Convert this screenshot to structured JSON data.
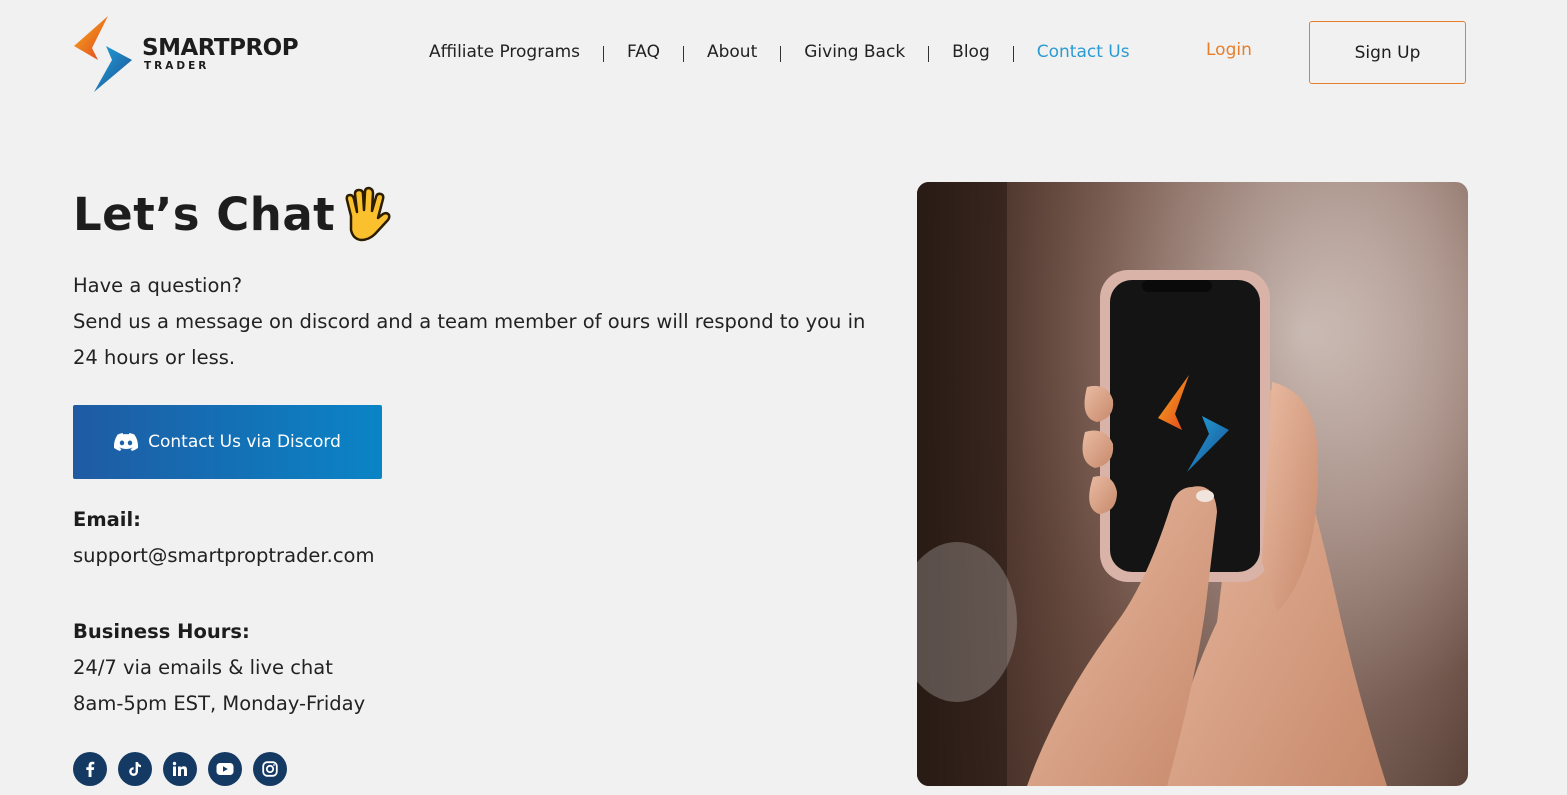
{
  "header": {
    "logo": {
      "main": "SMARTPROP",
      "sub": "TRADER"
    },
    "nav": [
      {
        "label": "Affiliate Programs"
      },
      {
        "label": "FAQ"
      },
      {
        "label": "About"
      },
      {
        "label": "Giving Back"
      },
      {
        "label": "Blog"
      },
      {
        "label": "Contact Us",
        "active": true
      }
    ],
    "login_label": "Login",
    "signup_label": "Sign Up"
  },
  "main": {
    "title": "Let’s Chat",
    "intro_line1": "Have a question?",
    "intro_line2": "Send us a message on discord and a team member of ours will respond to you in 24 hours or less.",
    "discord_button_label": "Contact Us via Discord",
    "email_label": "Email:",
    "email_value": "support@smartproptrader.com",
    "hours_label": "Business Hours:",
    "hours_line1": "24/7 via emails & live chat",
    "hours_line2": "8am-5pm EST, Monday-Friday",
    "socials": [
      "facebook-icon",
      "tiktok-icon",
      "linkedin-icon",
      "youtube-icon",
      "instagram-icon"
    ]
  },
  "colors": {
    "accent_orange": "#e57f2d",
    "accent_blue": "#2b9bd3",
    "social_bg": "#143a63",
    "discord_gradient_start": "#1f5ba3",
    "discord_gradient_end": "#0a84c6"
  }
}
